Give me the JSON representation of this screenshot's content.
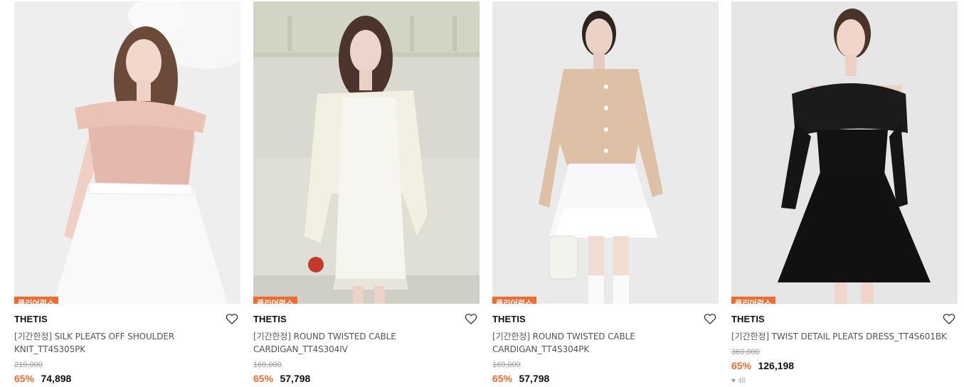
{
  "colors": {
    "accent": "#ef6b2e",
    "brand_text": "#111111",
    "name_text": "#555555",
    "original_price": "#999999"
  },
  "products": [
    {
      "badge": "클리어런스",
      "brand": "THETIS",
      "name": "[기간한정] SILK PLEATS OFF SHOULDER KNIT_TT4S305PK",
      "original_price": "219,000",
      "discount": "65%",
      "price": "74,898",
      "image_desc": "pink-off-shoulder-knit-white-tulle-skirt",
      "wishlist_icon": "heart-outline-icon"
    },
    {
      "badge": "클리어런스",
      "brand": "THETIS",
      "name": "[기간한정] ROUND TWISTED CABLE CARDIGAN_TT4S304IV",
      "original_price": "169,000",
      "discount": "65%",
      "price": "57,798",
      "image_desc": "ivory-cable-cardigan-white-dress",
      "wishlist_icon": "heart-outline-icon"
    },
    {
      "badge": "클리어런스",
      "brand": "THETIS",
      "name": "[기간한정] ROUND TWISTED CABLE CARDIGAN_TT4S304PK",
      "original_price": "169,000",
      "discount": "65%",
      "price": "57,798",
      "image_desc": "pink-cable-cardigan-white-tulle-skirt",
      "wishlist_icon": "heart-outline-icon"
    },
    {
      "badge": "클리어런스",
      "brand": "THETIS",
      "name": "[기간한정] TWIST DETAIL PLEATS DRESS_TT4S601BK",
      "original_price": "369,000",
      "discount": "65%",
      "price": "126,198",
      "likes": "48",
      "image_desc": "black-off-shoulder-dress",
      "wishlist_icon": "heart-outline-icon"
    }
  ]
}
